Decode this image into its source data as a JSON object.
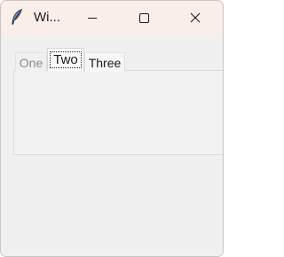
{
  "window": {
    "title": "Wi...",
    "icon": "feather-icon"
  },
  "titlebar_buttons": {
    "minimize": "minimize-icon",
    "maximize": "maximize-icon",
    "close": "close-icon"
  },
  "notebook": {
    "tabs": [
      {
        "label": "One",
        "state": "disabled"
      },
      {
        "label": "Two",
        "state": "selected"
      },
      {
        "label": "Three",
        "state": "normal"
      }
    ]
  },
  "colors": {
    "titlebar": "#f9eee8",
    "client": "#f0f0f0",
    "disabled_text": "#8c8c8c"
  }
}
